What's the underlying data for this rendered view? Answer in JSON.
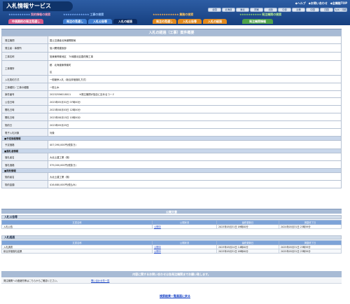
{
  "header": {
    "app_title": "入札情報サービス",
    "links": [
      "◆ヘルプ",
      "◆お問い合わせ",
      "◆全機能TOP"
    ],
    "regions": [
      "全国",
      "北海道",
      "東北",
      "関東",
      "北陸",
      "中部",
      "近畿",
      "中国",
      "四国",
      "九州・沖縄"
    ]
  },
  "categories": [
    {
      "title": "契約情報の検索",
      "stars": "★★★★★★★★★★"
    },
    {
      "title": "工事の検索",
      "stars": "★★★★★★★★★★★★"
    },
    {
      "title": "業務の検索",
      "stars": "★★★★★★★★★★★★"
    },
    {
      "title": "発注機関の検索",
      "stars": "★★★★★★★★★★"
    }
  ],
  "tabs": [
    "中長期的の発注見通し",
    "発注の見通し",
    "入札公告等",
    "入札の経過",
    "発注の見通し",
    "入札公告等",
    "入札の経過",
    "発注機関情報"
  ],
  "main": {
    "title": "入札の経過（工事）案件概要",
    "rows": [
      {
        "label": "発注機関",
        "value": "国土交通省北海道開発局"
      },
      {
        "label": "発注者・事務所",
        "value": "旭川開発建設部"
      },
      {
        "label": "工事名称",
        "value": "旭東東神楽地区　74南藤北区路改築工事"
      },
      {
        "label": "工事場所",
        "value": "都　北海道東神楽町",
        "value2": "区"
      },
      {
        "label": "入札契約方式",
        "value": "一般競争入札（総合評価落札方式）"
      },
      {
        "label": "工事種別／工事の種類",
        "value": "一般土木"
      },
      {
        "label": "案件番号",
        "value": "20232556018011",
        "note": "※発注機関が独自に定めるコード"
      },
      {
        "label": "公告日時",
        "value": "2023年05月31日 07時00分"
      },
      {
        "label": "開札日時",
        "value": "2023年08月03日 12時00分"
      },
      {
        "label": "開札日時",
        "value": "2023年08月15日 10時00分"
      },
      {
        "label": "契約日",
        "value": "2023年09月25日"
      },
      {
        "label": "電子入札対象",
        "value": "対象"
      }
    ],
    "section_planned": "■予定価格情報",
    "planned_rows": [
      {
        "label": "予定価格",
        "value": "407,090,000円(税抜き)"
      }
    ],
    "section_winner": "■落札者情報",
    "winner_rows": [
      {
        "label": "落札者名",
        "value": "大北土建工業（株）"
      },
      {
        "label": "落札価格",
        "value": "379,000,000円(税抜き)"
      }
    ],
    "section_contract": "■契約情報",
    "contract_rows": [
      {
        "label": "契約者名",
        "value": "大北土建工業（株）"
      },
      {
        "label": "契約金額",
        "value": "416,680,000円(税込み)"
      }
    ]
  },
  "documents": {
    "title": "公開文書",
    "headers": [
      "文書名称",
      "公開状況",
      "最終更新日",
      "掲載終了日"
    ],
    "group1": {
      "name": "入札公告等",
      "rows": [
        {
          "name": "入札公告",
          "status": "公開中",
          "updated": "2023年05月31日 09時00分",
          "end": "2024年05月31日 23時59分"
        }
      ]
    },
    "group2": {
      "name": "入札経過",
      "rows": [
        {
          "name": "入札調書",
          "status": "公開中",
          "updated": "2023年05月24日 14時00分",
          "end": "2025年05月31日 23時59分"
        },
        {
          "name": "総合評価落札結果",
          "status": "公開中",
          "updated": "2023年05月31日 09時00分",
          "end": "2025年05月31日 23時59分"
        }
      ]
    }
  },
  "inquiry": {
    "title": "内容に関するお問い合わせは各発注機関までお願い致します。",
    "text": "発注機関への連絡先等はこちらからご確認ください。",
    "link": "問い合わせ先一覧"
  },
  "back_link": "検索結果一覧画面に戻る"
}
